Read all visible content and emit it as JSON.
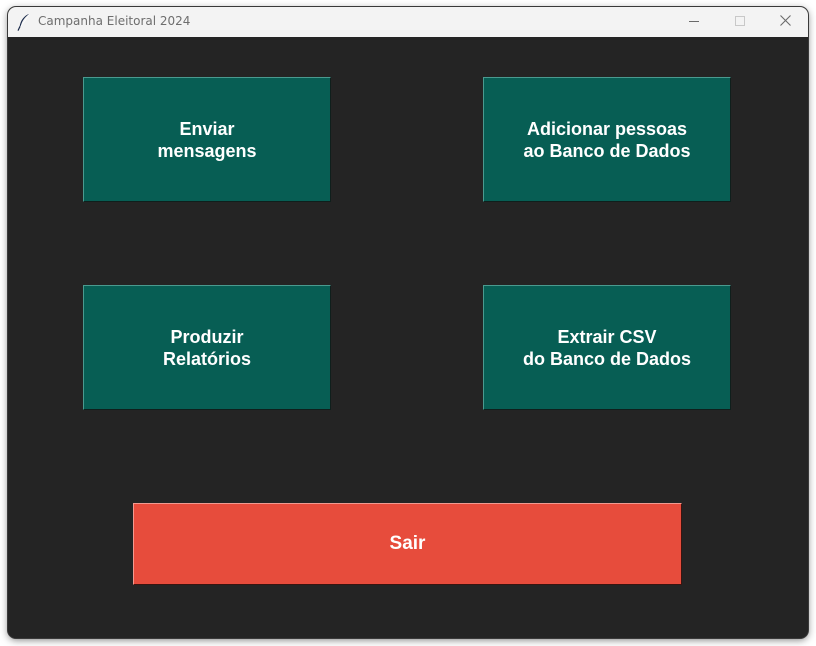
{
  "window": {
    "title": "Campanha Eleitoral 2024",
    "app_icon": "feather-icon",
    "controls": {
      "minimize_icon": "minimize-icon",
      "maximize_icon": "maximize-icon",
      "close_icon": "close-icon"
    }
  },
  "colors": {
    "background": "#242424",
    "tile": "#075e54",
    "exit": "#e74c3c",
    "text": "#ffffff"
  },
  "buttons": {
    "send_messages": "Enviar\nmensagens",
    "add_people": "Adicionar pessoas\nao Banco de Dados",
    "produce_reports": "Produzir\nRelatórios",
    "export_csv": "Extrair CSV\ndo Banco de Dados",
    "exit": "Sair"
  }
}
